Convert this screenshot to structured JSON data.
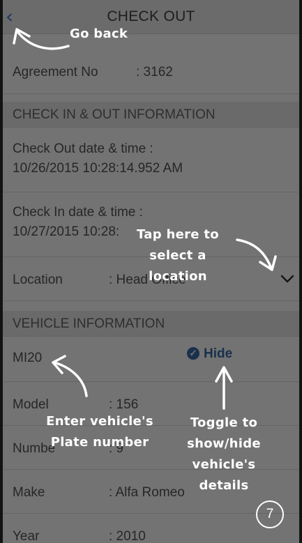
{
  "header": {
    "back_icon": "chevron-left-icon",
    "title": "CHECK OUT"
  },
  "agreement": {
    "label": "Agreement No",
    "value": ": 3162"
  },
  "sections": {
    "check": "CHECK IN & OUT INFORMATION",
    "vehicle": "VEHICLE INFORMATION"
  },
  "checkout": {
    "label": "Check Out date & time :",
    "value": "10/26/2015 10:28:14.952 AM"
  },
  "checkin": {
    "label": "Check In date & time :",
    "value": "10/27/2015 10:28:"
  },
  "location": {
    "label": "Location",
    "value": ": Head Office",
    "icon": "chevron-down-icon"
  },
  "plate": {
    "value": "MI20",
    "toggle_label": "Hide",
    "toggle_icon": "check-circle-icon"
  },
  "details": [
    {
      "label": "Model",
      "value": ": 156"
    },
    {
      "label": "Numbe",
      "value": ": 9"
    },
    {
      "label": "Make",
      "value": ": Alfa Romeo"
    },
    {
      "label": "Year",
      "value": ": 2010"
    }
  ],
  "tutorial": {
    "go_back": "Go back",
    "location_line1": "Tap here to",
    "location_line2": "select a location",
    "plate_line1": "Enter vehicle's",
    "plate_line2": "Plate number",
    "toggle_line1": "Toggle to",
    "toggle_line2": "show/hide",
    "toggle_line3": "vehicle's details",
    "step": "7"
  },
  "colors": {
    "accent": "#3a6aa8",
    "overlay": "rgba(0,0,0,0.55)"
  }
}
